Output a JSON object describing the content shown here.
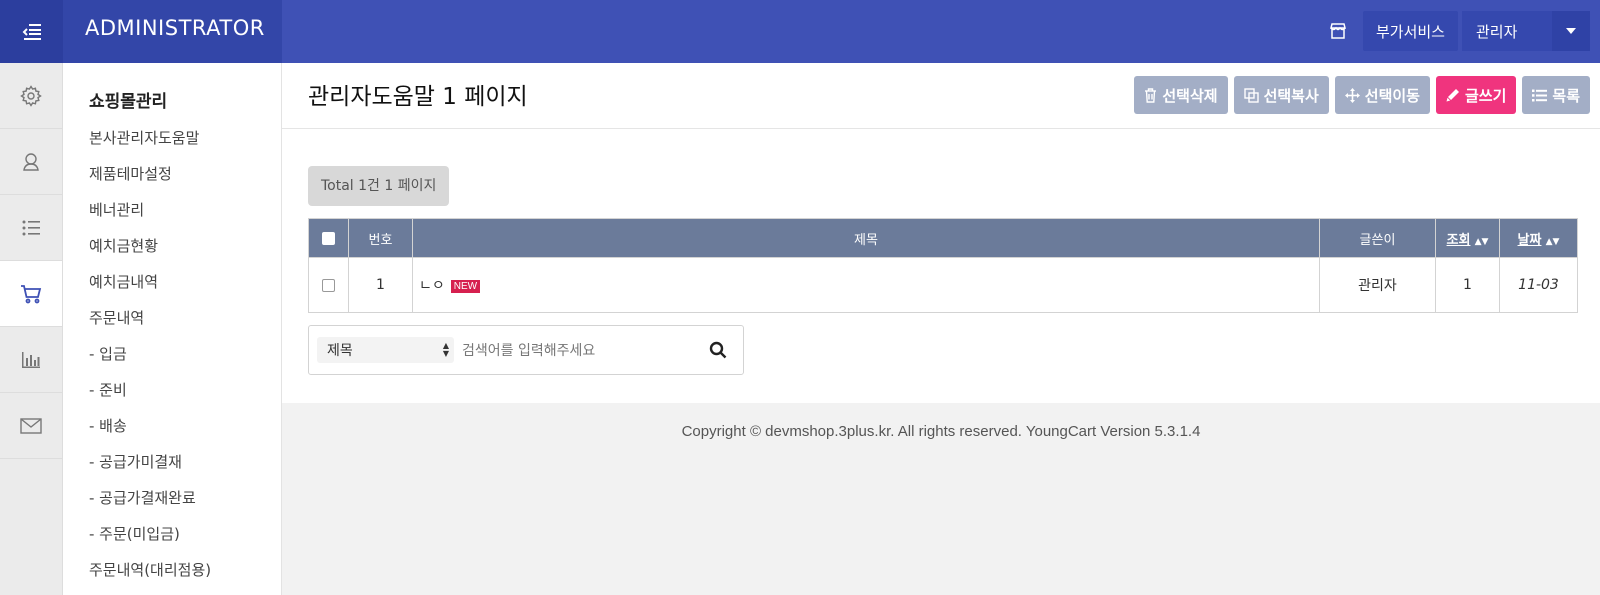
{
  "header": {
    "brand": "ADMINISTRATOR",
    "service_label": "부가서비스",
    "admin_label": "관리자"
  },
  "sidebar": {
    "section_title": "쇼핑몰관리",
    "items": [
      {
        "label": "본사관리자도움말"
      },
      {
        "label": "제품테마설정"
      },
      {
        "label": "베너관리"
      },
      {
        "label": "예치금현황"
      },
      {
        "label": "예치금내역"
      },
      {
        "label": "주문내역"
      },
      {
        "label": "- 입금"
      },
      {
        "label": "- 준비"
      },
      {
        "label": "- 배송"
      },
      {
        "label": "- 공급가미결재"
      },
      {
        "label": "- 공급가결재완료"
      },
      {
        "label": "- 주문(미입금)"
      },
      {
        "label": "주문내역(대리점용)"
      }
    ]
  },
  "rail": [
    "gear-icon",
    "user-icon",
    "list-icon",
    "cart-icon",
    "chart-icon",
    "mail-icon"
  ],
  "page": {
    "title": "관리자도움말 1 페이지",
    "total": "Total 1건 1 페이지"
  },
  "actions": {
    "delete": "선택삭제",
    "copy": "선택복사",
    "move": "선택이동",
    "write": "글쓰기",
    "list": "목록"
  },
  "table": {
    "headers": {
      "num": "번호",
      "subject": "제목",
      "writer": "글쓴이",
      "hits": "조회",
      "date": "날짜"
    },
    "rows": [
      {
        "num": "1",
        "subject": "ㄴㅇ",
        "badge": "NEW",
        "writer": "관리자",
        "hits": "1",
        "date": "11-03"
      }
    ]
  },
  "search": {
    "field": "제목",
    "placeholder": "검색어를 입력해주세요"
  },
  "footer": {
    "copyright": "Copyright © devmshop.3plus.kr. All rights reserved. YoungCart Version 5.3.1.4"
  },
  "colors": {
    "header": "#3f51b5",
    "write_button": "#f0347e",
    "table_header": "#6b7b9a",
    "new_badge": "#d6204f"
  }
}
